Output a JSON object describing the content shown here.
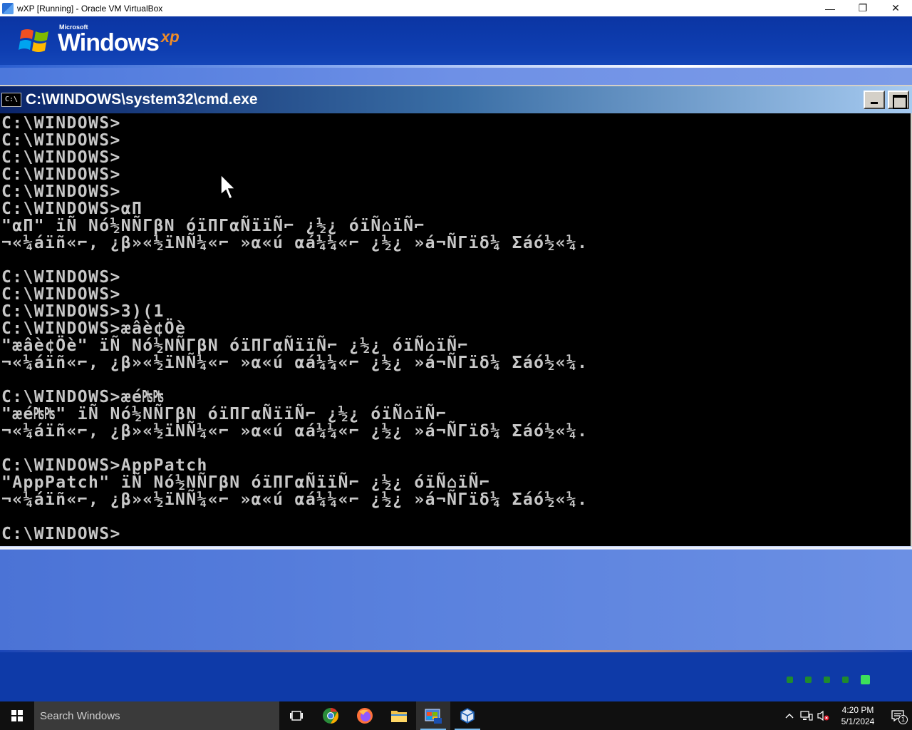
{
  "host_window": {
    "title": "wXP [Running] - Oracle VM VirtualBox",
    "minimize_symbol": "—",
    "restore_symbol": "❐",
    "close_symbol": "✕"
  },
  "xp_logo": {
    "microsoft": "Microsoft",
    "windows": "Windows",
    "xp": "xp"
  },
  "cmd_window": {
    "icon_text": "C:\\",
    "title": "C:\\WINDOWS\\system32\\cmd.exe",
    "lines": [
      "C:\\WINDOWS>",
      "C:\\WINDOWS>",
      "C:\\WINDOWS>",
      "C:\\WINDOWS>",
      "C:\\WINDOWS>",
      "C:\\WINDOWS>αΠ",
      "\"αΠ\" ïÑ Nó½NÑΓβN óïΠΓαÑïïÑ⌐ ¿½¿ óïÑ⌂ïÑ⌐",
      "¬«¼áïñ«⌐, ¿β»«½ïNÑ¼«⌐ »α«ú αá¼¼«⌐ ¿½¿ »á¬ÑΓïδ¼ Σáó½«¼.",
      "",
      "C:\\WINDOWS>",
      "C:\\WINDOWS>",
      "C:\\WINDOWS>3)(1",
      "C:\\WINDOWS>æâè¢Öè",
      "\"æâè¢Öè\" ïÑ Nó½NÑΓβN óïΠΓαÑïïÑ⌐ ¿½¿ óïÑ⌂ïÑ⌐",
      "¬«¼áïñ«⌐, ¿β»«½ïNÑ¼«⌐ »α«ú αá¼¼«⌐ ¿½¿ »á¬ÑΓïδ¼ Σáó½«¼.",
      "",
      "C:\\WINDOWS>æé₧₧",
      "\"æé₧₧\" ïÑ Nó½NÑΓβN óïΠΓαÑïïÑ⌐ ¿½¿ óïÑ⌂ïÑ⌐",
      "¬«¼áïñ«⌐, ¿β»«½ïNÑ¼«⌐ »α«ú αá¼¼«⌐ ¿½¿ »á¬ÑΓïδ¼ Σáó½«¼.",
      "",
      "C:\\WINDOWS>AppPatch",
      "\"AppPatch\" ïÑ Nó½NÑΓβN óïΠΓαÑïïÑ⌐ ¿½¿ óïÑ⌂ïÑ⌐",
      "¬«¼áïñ«⌐, ¿β»«½ïNÑ¼«⌐ »α«ú αá¼¼«⌐ ¿½¿ »á¬ÑΓïδ¼ Σáó½«¼.",
      "",
      "C:\\WINDOWS>"
    ]
  },
  "taskbar": {
    "search_placeholder": "Search Windows",
    "apps": [
      "task-view",
      "chrome",
      "firefox",
      "file-explorer",
      "virtualbox-xp",
      "virtualbox-manager"
    ],
    "clock_time": "4:20 PM",
    "clock_date": "5/1/2024",
    "notification_count": "1"
  },
  "colors": {
    "console_text": "#c8c8c8",
    "console_bg": "#000000",
    "xp_blue": "#0e3aa8",
    "boot_dot": "#1f8a2e",
    "boot_dot_active": "#3de05a"
  }
}
